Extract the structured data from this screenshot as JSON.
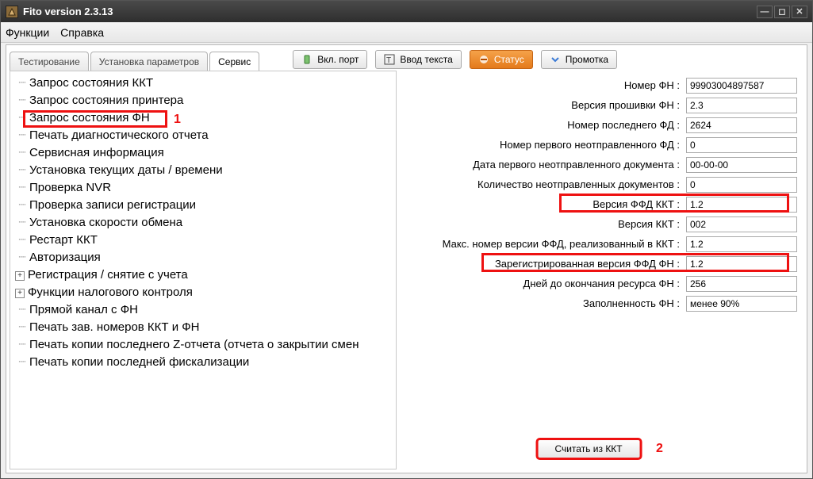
{
  "window": {
    "title": "Fito version 2.3.13"
  },
  "menu": {
    "functions": "Функции",
    "help": "Справка"
  },
  "tabs": {
    "testing": "Тестирование",
    "params": "Установка параметров",
    "service": "Сервис"
  },
  "toolbar": {
    "port_on": "Вкл. порт",
    "text_input": "Ввод текста",
    "status": "Статус",
    "feed": "Промотка"
  },
  "tree": {
    "items": [
      "Запрос состояния ККТ",
      "Запрос состояния принтера",
      "Запрос состояния ФН",
      "Печать диагностического отчета",
      "Сервисная информация",
      "Установка текущих даты / времени",
      "Проверка NVR",
      "Проверка записи регистрации",
      "Установка скорости обмена",
      "Рестарт ККТ",
      "Авторизация",
      "Регистрация / снятие с учета",
      "Функции налогового контроля",
      "Прямой канал с ФН",
      "Печать зав. номеров ККТ и ФН",
      "Печать копии последнего Z-отчета (отчета о закрытии смен",
      "Печать копии последней фискализации"
    ]
  },
  "annotations": {
    "one": "1",
    "two": "2"
  },
  "form": {
    "rows": [
      {
        "label": "Номер ФН :",
        "value": "99903004897587"
      },
      {
        "label": "Версия прошивки ФН :",
        "value": "2.3"
      },
      {
        "label": "Номер последнего ФД :",
        "value": "2624"
      },
      {
        "label": "Номер первого неотправленного ФД :",
        "value": "0"
      },
      {
        "label": "Дата первого неотправленного документа :",
        "value": "00-00-00"
      },
      {
        "label": "Количество неотправленных документов :",
        "value": "0"
      },
      {
        "label": "Версия ФФД ККТ :",
        "value": "1.2"
      },
      {
        "label": "Версия ККТ :",
        "value": "002"
      },
      {
        "label": "Макс. номер версии ФФД, реализованный в ККТ :",
        "value": "1.2"
      },
      {
        "label": "Зарегистрированная версия ФФД ФН :",
        "value": "1.2"
      },
      {
        "label": "Дней до окончания ресурса ФН :",
        "value": "256"
      },
      {
        "label": "Заполненность ФН :",
        "value": "менее 90%"
      }
    ]
  },
  "bottom": {
    "read": "Считать из ККТ"
  }
}
